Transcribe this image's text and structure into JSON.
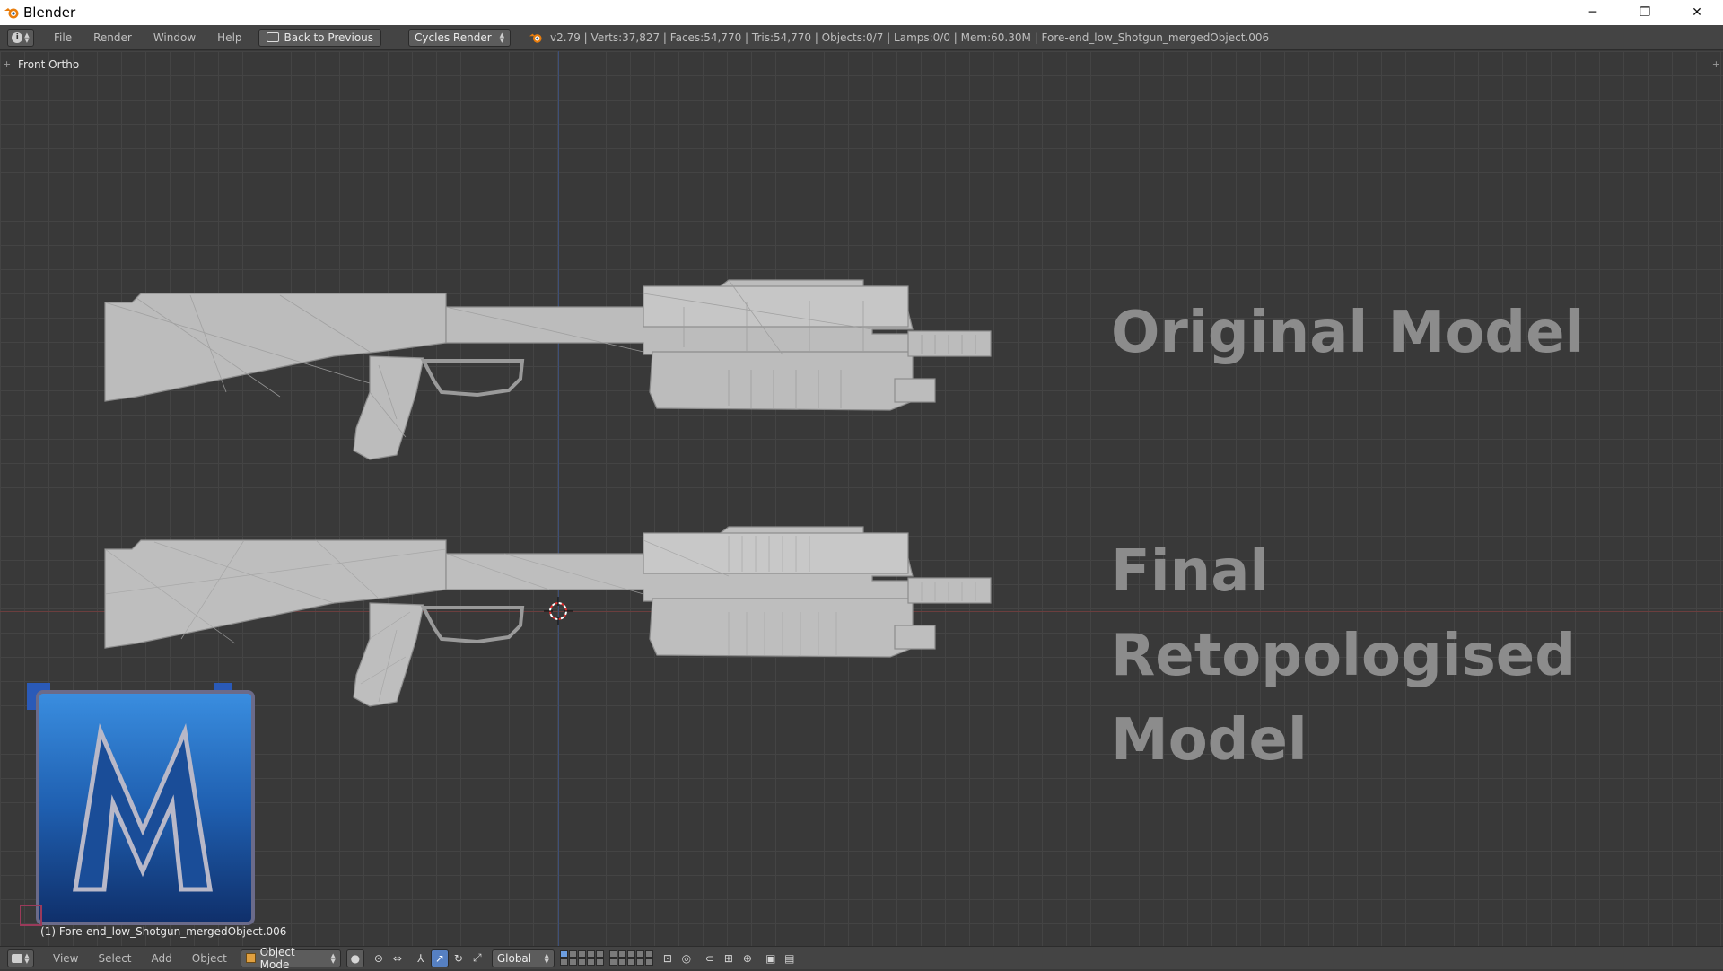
{
  "window": {
    "title": "Blender",
    "minimize": "─",
    "restore": "❐",
    "close": "✕"
  },
  "info_header": {
    "menu": [
      "File",
      "Render",
      "Window",
      "Help"
    ],
    "back_button": "Back to Previous",
    "render_engine": "Cycles Render",
    "stats": "v2.79 | Verts:37,827 | Faces:54,770 | Tris:54,770 | Objects:0/7 | Lamps:0/0 | Mem:60.30M | Fore-end_low_Shotgun_mergedObject.006"
  },
  "viewport": {
    "view_name": "Front Ortho",
    "label_original": "Original Model",
    "label_final": "Final Retopologised Model",
    "object_name": "(1) Fore-end_low_Shotgun_mergedObject.006",
    "logo_letter": "M"
  },
  "view_header": {
    "menu": [
      "View",
      "Select",
      "Add",
      "Object"
    ],
    "mode": "Object Mode",
    "orientation": "Global"
  },
  "colors": {
    "viewport_bg": "#393939",
    "grid": "#444444",
    "header_bg": "#444444",
    "model": "#bdbdbd",
    "label": "#8c8c8c",
    "logo_blue": "#1f5fb0"
  }
}
